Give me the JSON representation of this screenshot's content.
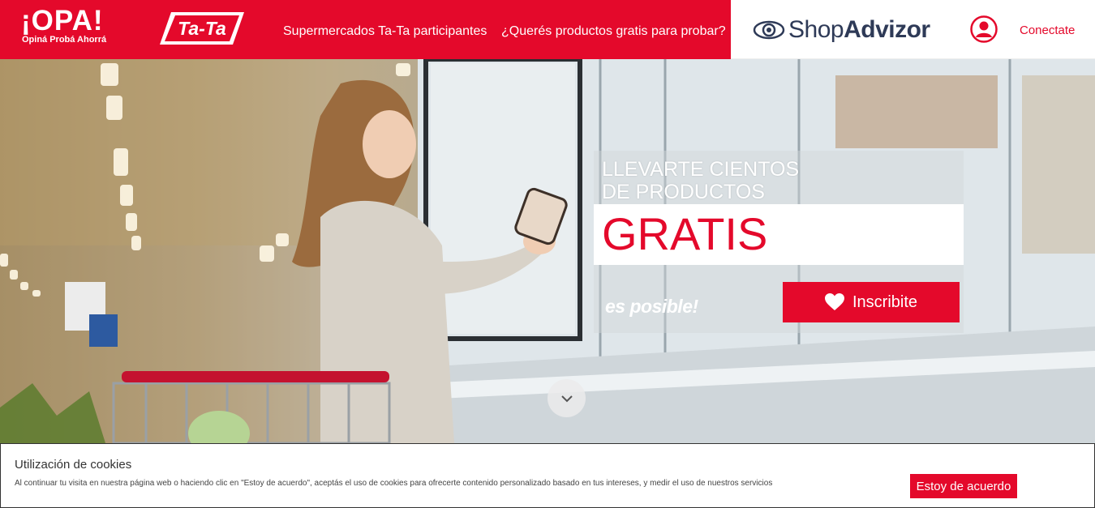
{
  "header": {
    "brand": {
      "main": "¡OPA!",
      "tagline": "Opiná Probá Ahorrá"
    },
    "partner_logo": "Ta-Ta",
    "nav": [
      {
        "label": "Supermercados Ta-Ta participantes"
      },
      {
        "label": "¿Querés productos gratis para probar?"
      }
    ],
    "shopadvizor": {
      "part1": "Shop",
      "part2": "Advizor"
    },
    "login_label": "Conectate"
  },
  "hero": {
    "line1": "LLEVARTE CIENTOS",
    "line2": "DE  PRODUCTOS",
    "highlight": "GRATIS",
    "subline": "es posible!",
    "cta_label": "Inscribite"
  },
  "cookies": {
    "title": "Utilización de cookies",
    "text": "Al continuar tu visita en nuestra página web o haciendo clic en \"Estoy de acuerdo\", aceptás el uso de cookies para ofrecerte contenido personalizado basado en tus intereses, y medir el uso de nuestros servicios",
    "accept_label": "Estoy de acuerdo"
  },
  "colors": {
    "brand_red": "#e4092b",
    "shopadvizor_blue": "#2e3a57"
  },
  "icons": [
    "user-icon",
    "heart-icon",
    "chevron-down-icon",
    "shopadvizor-eye-icon"
  ]
}
